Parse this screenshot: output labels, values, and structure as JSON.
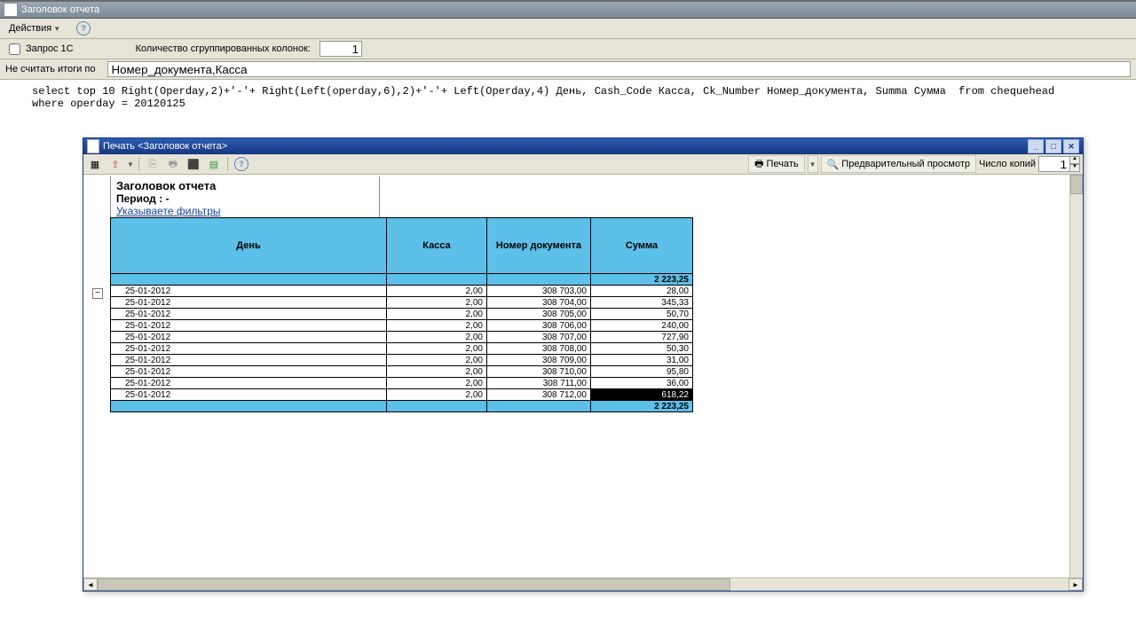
{
  "window": {
    "title": "Заголовок отчета"
  },
  "menubar": {
    "actions": "Действия"
  },
  "params": {
    "checkbox_label": "Запрос 1С",
    "grouped_cols_label": "Количество сгруппированных колонок:",
    "grouped_cols_value": "1",
    "no_totals_label": "Не считать итоги по",
    "no_totals_value": "Номер_документа,Касса"
  },
  "sql": "select top 10 Right(Operday,2)+'-'+ Right(Left(operday,6),2)+'-'+ Left(Operday,4) День, Cash_Code Касса, Ck_Number Номер_документа, Summa Сумма  from chequehead\nwhere operday = 20120125",
  "print_window": {
    "title": "Печать <Заголовок отчета>",
    "toolbar": {
      "print_btn": "Печать",
      "preview_btn": "Предварительный просмотр",
      "copies_label": "Число копий",
      "copies_value": "1"
    },
    "report": {
      "title": "Заголовок отчета",
      "period": "Период :  -",
      "filters": "Указываете фильтры",
      "columns": [
        "День",
        "Касса",
        "Номер документа",
        "Сумма"
      ],
      "group_total": "2 223,25",
      "rows": [
        {
          "d": "25-01-2012",
          "k": "2,00",
          "n": "308 703,00",
          "s": "28,00"
        },
        {
          "d": "25-01-2012",
          "k": "2,00",
          "n": "308 704,00",
          "s": "345,33"
        },
        {
          "d": "25-01-2012",
          "k": "2,00",
          "n": "308 705,00",
          "s": "50,70"
        },
        {
          "d": "25-01-2012",
          "k": "2,00",
          "n": "308 706,00",
          "s": "240,00"
        },
        {
          "d": "25-01-2012",
          "k": "2,00",
          "n": "308 707,00",
          "s": "727,90"
        },
        {
          "d": "25-01-2012",
          "k": "2,00",
          "n": "308 708,00",
          "s": "50,30"
        },
        {
          "d": "25-01-2012",
          "k": "2,00",
          "n": "308 709,00",
          "s": "31,00"
        },
        {
          "d": "25-01-2012",
          "k": "2,00",
          "n": "308 710,00",
          "s": "95,80"
        },
        {
          "d": "25-01-2012",
          "k": "2,00",
          "n": "308 711,00",
          "s": "36,00"
        },
        {
          "d": "25-01-2012",
          "k": "2,00",
          "n": "308 712,00",
          "s": "618,22"
        }
      ],
      "footer_total": "2 223,25"
    }
  }
}
